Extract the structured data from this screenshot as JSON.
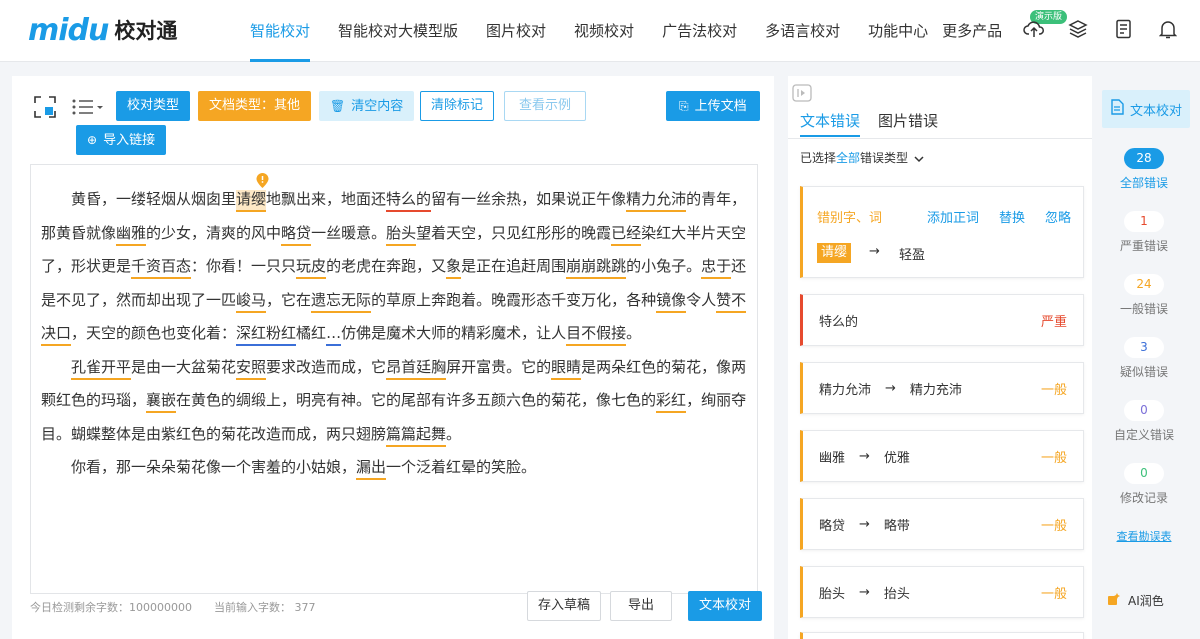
{
  "brand": {
    "logo": "midu",
    "name": "校对通"
  },
  "nav": {
    "items": [
      "智能校对",
      "智能校对大模型版",
      "图片校对",
      "视频校对",
      "广告法校对",
      "多语言校对",
      "功能中心",
      "更多产品"
    ],
    "demo_badge": "演示版",
    "icons": [
      "cloud-upload-icon",
      "layers-icon",
      "document-edit-icon",
      "bell-icon"
    ]
  },
  "toolbar": {
    "check_type": "校对类型",
    "doc_type": "文档类型：其他",
    "clear": "清空内容",
    "clear_marks": "清除标记",
    "view_example": "查看示例",
    "upload": "上传文档",
    "import_link": "导入链接"
  },
  "editor": {
    "p1": {
      "a": "黄昏，一缕轻烟从烟囱里",
      "e1": "请缨",
      "b": "地飘出来，地面还",
      "e2": "特么的",
      "c": "留有一丝余热，如果说正午像",
      "e3": "精力允沛",
      "d": "的青年，那黄昏就像",
      "e4": "幽雅",
      "e": "的少女，清爽的风中",
      "e5": "略贷",
      "f": "一丝暖意。",
      "e6": "胎头",
      "g": "望着天空，只见红彤彤的晚霞",
      "e7": "已经",
      "h": "染红大半片天空了，形状更是",
      "e8": "千资百态",
      "i": "：你看！一只只",
      "e9": "玩皮",
      "j": "的老虎在奔跑，又",
      "e10": "象",
      "k": "是正在追赶周围",
      "e11": "崩崩跳跳",
      "l": "的小兔子。",
      "e12": "忠于",
      "m": "还是不见了，然而却出现了一匹",
      "e13": "峻马",
      "n": "，它在",
      "e14": "遗忘无际",
      "o": "的草原上奔跑着。晚霞形态千变万化，各种",
      "e15": "镜像",
      "p": "令人",
      "e16": "赞不决口",
      "q": "，天空的颜色也变化着：",
      "e17": "深红粉红",
      "r": "橘红",
      "e18": "…",
      "s": "仿佛是魔术大师的精彩魔术，让人",
      "e19": "目不假接",
      "t": "。"
    },
    "p2": {
      "e1": "孔雀开平",
      "a": "是由一大盆菊花",
      "e2": "安照",
      "b": "要求改造而成，它",
      "e3": "昂首廷胸",
      "c": "屏开富贵。它的",
      "e4": "眼睛",
      "d": "是两朵红色的菊花，像两颗红色的玛瑙，",
      "e5": "襄嵌",
      "e": "在黄色的绸缎上，明亮有神。它的尾部有许多五颜六色的菊花，像七色的",
      "e6": "彩红",
      "f": "，绚丽夺目。蝴蝶整体是由紫红色的菊花改造而成，两只翅膀",
      "e7": "篇篇起舞",
      "g": "。"
    },
    "p3": {
      "a": "你看，那一朵朵菊花像一个害羞的小姑娘，",
      "e1": "漏出",
      "b": "一个泛着红晕的笑脸。"
    }
  },
  "footer": {
    "remaining": "今日检测剩余字数：100000000",
    "current": "当前输入字数：  377",
    "save_draft": "存入草稿",
    "export": "导出",
    "check": "文本校对"
  },
  "results": {
    "tabs": [
      "文本错误",
      "图片错误"
    ],
    "filter_prefix": "已选择",
    "filter_sel": "全部",
    "filter_suffix": "错误类型",
    "first": {
      "category": "错别字、词",
      "actions": [
        "添加正词",
        "替换",
        "忽略"
      ],
      "original": "请缨",
      "suggestion": "轻盈"
    },
    "cards": [
      {
        "original": "特么的",
        "suggestion": "",
        "level": "严重"
      },
      {
        "original": "精力允沛",
        "suggestion": "精力充沛",
        "level": "一般"
      },
      {
        "original": "幽雅",
        "suggestion": "优雅",
        "level": "一般"
      },
      {
        "original": "略贷",
        "suggestion": "略带",
        "level": "一般"
      },
      {
        "original": "胎头",
        "suggestion": "抬头",
        "level": "一般"
      }
    ],
    "arrow": "→"
  },
  "sidebar": {
    "text_check": "文本校对",
    "stats": [
      {
        "count": "28",
        "label": "全部错误"
      },
      {
        "count": "1",
        "label": "严重错误"
      },
      {
        "count": "24",
        "label": "一般错误"
      },
      {
        "count": "3",
        "label": "疑似错误"
      },
      {
        "count": "0",
        "label": "自定义错误"
      },
      {
        "count": "0",
        "label": "修改记录"
      }
    ],
    "help": "查看勘误表",
    "ai": "AI润色"
  },
  "colors": {
    "accent": "#1a9be6",
    "warning": "#f5a623",
    "severe": "#e64a2e",
    "suspect": "#3b6fd8"
  }
}
